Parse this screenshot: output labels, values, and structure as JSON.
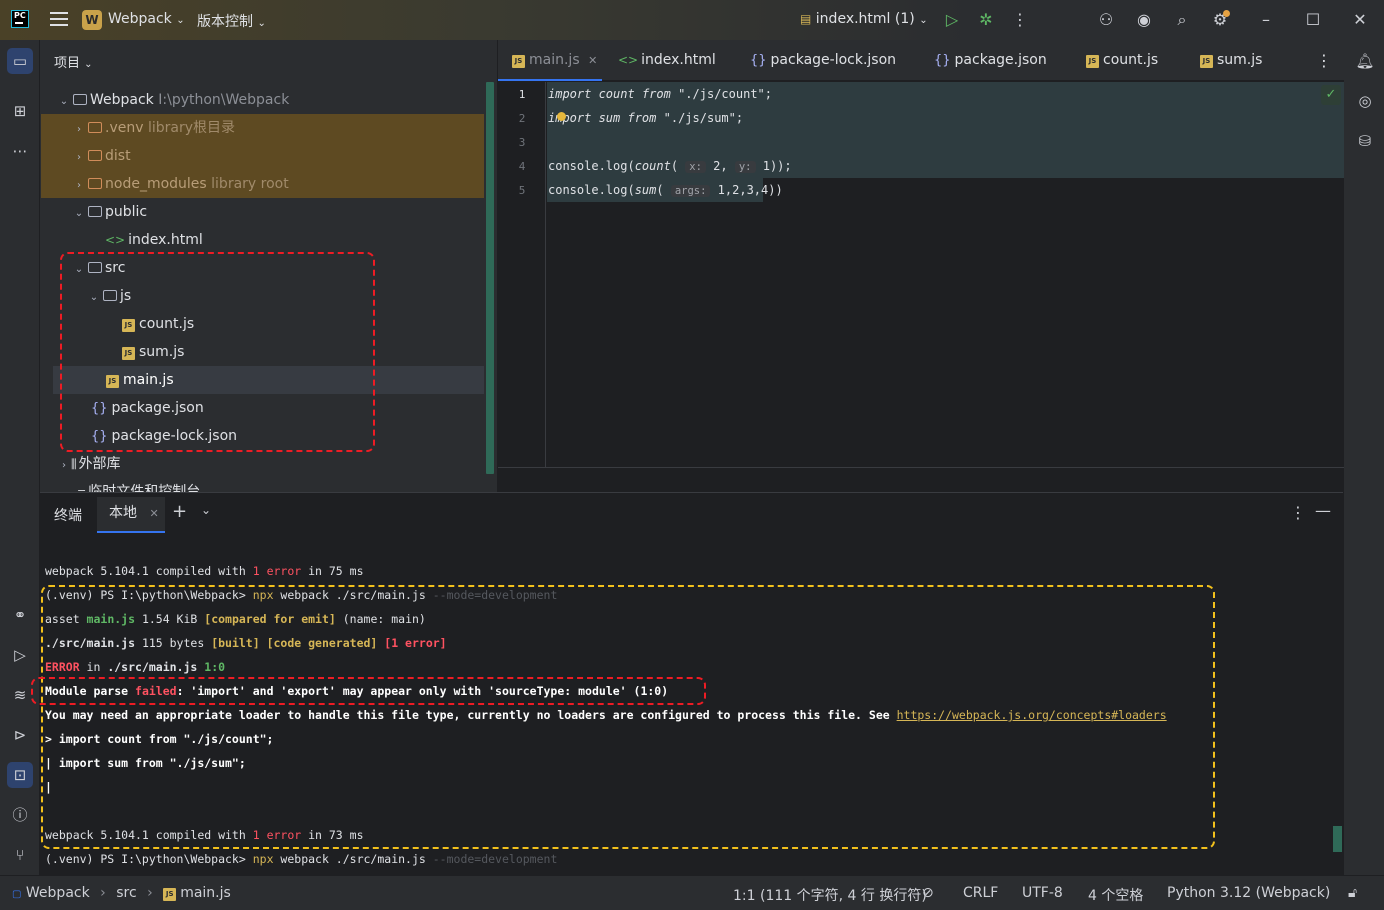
{
  "titlebar": {
    "project_badge": "W",
    "project_name": "Webpack",
    "vcs": "版本控制",
    "run_config": "index.html (1)"
  },
  "project_panel": {
    "header": "项目",
    "root": {
      "name": "Webpack",
      "path": "I:\\python\\Webpack"
    },
    "items": [
      {
        "name": ".venv",
        "note": "library根目录"
      },
      {
        "name": "dist",
        "note": ""
      },
      {
        "name": "node_modules",
        "note": "library root"
      },
      {
        "name": "public",
        "note": ""
      },
      {
        "name": "index.html",
        "note": ""
      },
      {
        "name": "src",
        "note": ""
      },
      {
        "name": "js",
        "note": ""
      },
      {
        "name": "count.js",
        "note": ""
      },
      {
        "name": "sum.js",
        "note": ""
      },
      {
        "name": "main.js",
        "note": ""
      },
      {
        "name": "package.json",
        "note": ""
      },
      {
        "name": "package-lock.json",
        "note": ""
      },
      {
        "name": "外部库",
        "note": ""
      },
      {
        "name": "临时文件和控制台",
        "note": ""
      }
    ]
  },
  "editor": {
    "tabs": [
      "main.js",
      "index.html",
      "package-lock.json",
      "package.json",
      "count.js",
      "sum.js"
    ],
    "line_numbers": [
      "1",
      "2",
      "3",
      "4",
      "5"
    ],
    "code": {
      "l1_kw1": "import",
      "l1_id": " count ",
      "l1_kw2": "from",
      "l1_str": " \"./js/count\";",
      "l2_kw1": "import",
      "l2_id": " sum ",
      "l2_kw2": "from",
      "l2_str": " \"./js/sum\";",
      "l4_pre": "console.log(",
      "l4_fn": "count",
      "l4_open": "( ",
      "l4_hint1": "x:",
      "l4_v1": " 2, ",
      "l4_hint2": "y:",
      "l4_v2": " 1));",
      "l5_pre": "console.log(",
      "l5_fn": "sum",
      "l5_open": "( ",
      "l5_hint": "args:",
      "l5_v": " 1,2,3,4))"
    }
  },
  "terminal": {
    "title": "终端",
    "tab": "本地",
    "lines": {
      "l1_a": "webpack 5.104.1 compiled with ",
      "l1_b": "1 error",
      "l1_c": " in 75 ms",
      "l2_a": "(.venv) PS I:\\python\\Webpack> ",
      "l2_b": "npx",
      "l2_c": " webpack ./src/main.js ",
      "l2_d": "--mode=development",
      "l3_a": "asset ",
      "l3_b": "main.js",
      "l3_c": " 1.54 KiB ",
      "l3_d": "[compared for emit]",
      "l3_e": " (name: main)",
      "l4_a": "./src/main.js",
      "l4_b": " 115 bytes ",
      "l4_c": "[built] [code generated]",
      "l4_d": " [1 error]",
      "l5_a": "ERROR",
      "l5_b": " in ",
      "l5_c": "./src/main.js",
      "l5_d": " 1:0",
      "l6_a": "Module parse ",
      "l6_b": "failed",
      "l6_c": ": 'import' and 'export' may appear only with 'sourceType: module' (1:0)",
      "l7_a": "You may need an appropriate loader to handle this file type, currently no loaders are configured to process this file. See ",
      "l7_link": "https://webpack.js.org/concepts#loaders",
      "l8": "> import count from \"./js/count\";",
      "l9": "| import sum from \"./js/sum\";",
      "l10": "|",
      "l11_a": "webpack 5.104.1 compiled with ",
      "l11_b": "1 error",
      "l11_c": " in 73 ms",
      "l12_a": "(.venv) PS I:\\python\\Webpack> ",
      "l12_b": "npx",
      "l12_c": " webpack ./src/main.js ",
      "l12_d": "--mode=development"
    }
  },
  "statusbar": {
    "crumb_project": "Webpack",
    "crumb_src": "src",
    "crumb_file": "main.js",
    "position": "1:1 (111 个字符, 4 行 换行符)",
    "line_sep": "CRLF",
    "encoding": "UTF-8",
    "indent": "4 个空格",
    "interpreter": "Python 3.12 (Webpack)"
  },
  "colors": {
    "accent": "#3574f0",
    "error": "#ff5261",
    "annotation_red": "#ee1c24",
    "annotation_yellow": "#f2c01c"
  }
}
